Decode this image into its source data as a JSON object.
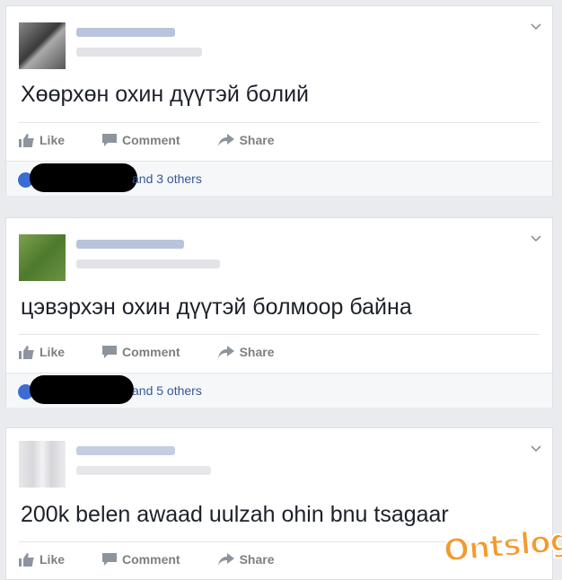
{
  "posts": [
    {
      "text": "Хөөрхөн охин дүүтэй болий",
      "actions": {
        "like": "Like",
        "comment": "Comment",
        "share": "Share"
      },
      "likes_text": "and 3 others",
      "colors": {
        "avatar": "#5a5a5a",
        "name_blur": "#b9c4dc",
        "meta_blur": "#e2e2e6"
      }
    },
    {
      "text": "цэвэрхэн охин дүүтэй болмоор байна",
      "actions": {
        "like": "Like",
        "comment": "Comment",
        "share": "Share"
      },
      "likes_text": "and 5 others",
      "colors": {
        "avatar": "#5f8a3a",
        "name_blur": "#b9c4dc",
        "meta_blur": "#e2e2e6"
      }
    },
    {
      "text": "200k belen awaad uulzah ohin bnu tsagaar",
      "actions": {
        "like": "Like",
        "comment": "Comment",
        "share": "Share"
      }
    }
  ],
  "watermark": "Ontslog"
}
